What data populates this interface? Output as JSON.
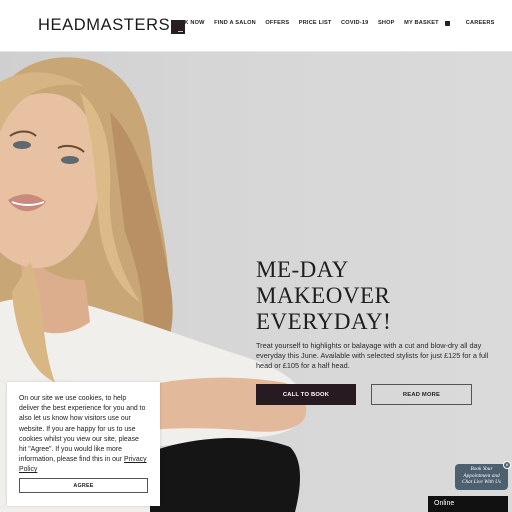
{
  "header": {
    "logo_text": "HEADMASTERS",
    "nav": [
      "BOOK NOW",
      "FIND A SALON",
      "OFFERS",
      "PRICE LIST",
      "COVID-19",
      "SHOP"
    ],
    "basket_label": "MY BASKET",
    "careers_label": "CAREERS"
  },
  "hero": {
    "headline": [
      "ME-DAY",
      "MAKEOVER",
      "EVERYDAY!"
    ],
    "subtext": "Treat yourself to highlights or balayage with a cut and blow-dry all day everyday this June. Available with selected stylists for just £125 for a full head or £105 for a half head.",
    "book_button": "CALL TO BOOK",
    "more_button": "READ MORE"
  },
  "cookie": {
    "text": "On our site we use cookies, to help deliver the best experience for you and to also let us know how visitors use our website. If you are happy for us to use cookies whilst you view our site, please hit \"Agree\". If you would like more information, please find this in our",
    "link": "Privacy Policy",
    "agree": "AGREE"
  },
  "chat": {
    "bubble_line1": "Book Your",
    "bubble_line2": "Appointment and",
    "bubble_line3": "Chat Live With Us",
    "close": "×",
    "online": "Online"
  },
  "colors": {
    "brand_dark": "#271a20",
    "hero_bg": "#d6d6d6",
    "chat_bg": "#4c6070"
  }
}
